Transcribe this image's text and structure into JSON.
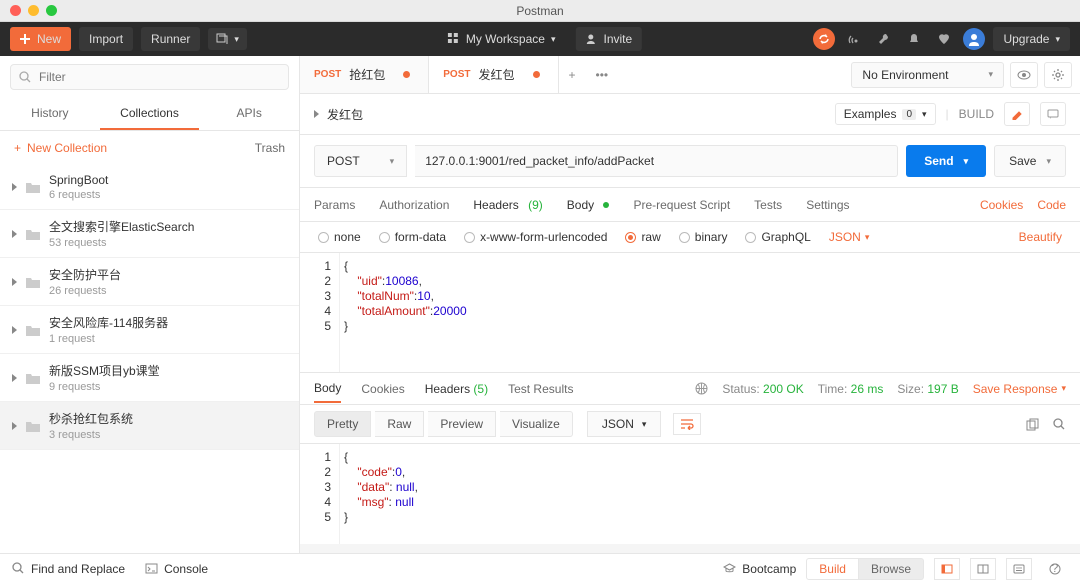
{
  "app_title": "Postman",
  "toolbar": {
    "new": "New",
    "import": "Import",
    "runner": "Runner",
    "workspace": "My Workspace",
    "invite": "Invite",
    "upgrade": "Upgrade"
  },
  "sidebar": {
    "filter_placeholder": "Filter",
    "tabs": [
      "History",
      "Collections",
      "APIs"
    ],
    "new_collection": "New Collection",
    "trash": "Trash",
    "collections": [
      {
        "name": "SpringBoot",
        "sub": "6 requests"
      },
      {
        "name": "全文搜索引擎ElasticSearch",
        "sub": "53 requests"
      },
      {
        "name": "安全防护平台",
        "sub": "26 requests"
      },
      {
        "name": "安全风险库-114服务器",
        "sub": "1 request"
      },
      {
        "name": "新版SSM项目yb课堂",
        "sub": "9 requests"
      },
      {
        "name": "秒杀抢红包系统",
        "sub": "3 requests"
      }
    ],
    "selected": 5
  },
  "tabs": [
    {
      "method": "POST",
      "label": "抢红包",
      "dirty": true,
      "active": false
    },
    {
      "method": "POST",
      "label": "发红包",
      "dirty": true,
      "active": true
    }
  ],
  "env": {
    "label": "No Environment"
  },
  "breadcrumb": {
    "title": "发红包",
    "examples": "Examples",
    "examples_count": "0",
    "build": "BUILD"
  },
  "request": {
    "method": "POST",
    "url": "127.0.0.1:9001/red_packet_info/addPacket",
    "send": "Send",
    "save": "Save",
    "subtabs": {
      "params": "Params",
      "auth": "Authorization",
      "headers": "Headers",
      "headers_count": "(9)",
      "body": "Body",
      "prereq": "Pre-request Script",
      "tests": "Tests",
      "settings": "Settings",
      "cookies": "Cookies",
      "code": "Code"
    },
    "body_opts": {
      "none": "none",
      "formdata": "form-data",
      "urlencoded": "x-www-form-urlencoded",
      "raw": "raw",
      "binary": "binary",
      "graphql": "GraphQL",
      "type": "JSON",
      "beautify": "Beautify"
    },
    "body_lines": [
      {
        "n": "1",
        "t": "{"
      },
      {
        "n": "2",
        "t": "    \"uid\":10086,"
      },
      {
        "n": "3",
        "t": "    \"totalNum\":10,"
      },
      {
        "n": "4",
        "t": "    \"totalAmount\":20000"
      },
      {
        "n": "5",
        "t": "}"
      }
    ]
  },
  "response": {
    "tabs": {
      "body": "Body",
      "cookies": "Cookies",
      "headers": "Headers",
      "headers_count": "(5)",
      "tests": "Test Results"
    },
    "status_label": "Status:",
    "status": "200 OK",
    "time_label": "Time:",
    "time": "26 ms",
    "size_label": "Size:",
    "size": "197 B",
    "save": "Save Response",
    "view": {
      "pretty": "Pretty",
      "raw": "Raw",
      "preview": "Preview",
      "visualize": "Visualize",
      "type": "JSON"
    },
    "lines": [
      {
        "n": "1",
        "t": "{"
      },
      {
        "n": "2",
        "t": "    \"code\": 0,"
      },
      {
        "n": "3",
        "t": "    \"data\": null,"
      },
      {
        "n": "4",
        "t": "    \"msg\": null"
      },
      {
        "n": "5",
        "t": "}"
      }
    ]
  },
  "footer": {
    "find": "Find and Replace",
    "console": "Console",
    "bootcamp": "Bootcamp",
    "build": "Build",
    "browse": "Browse"
  }
}
